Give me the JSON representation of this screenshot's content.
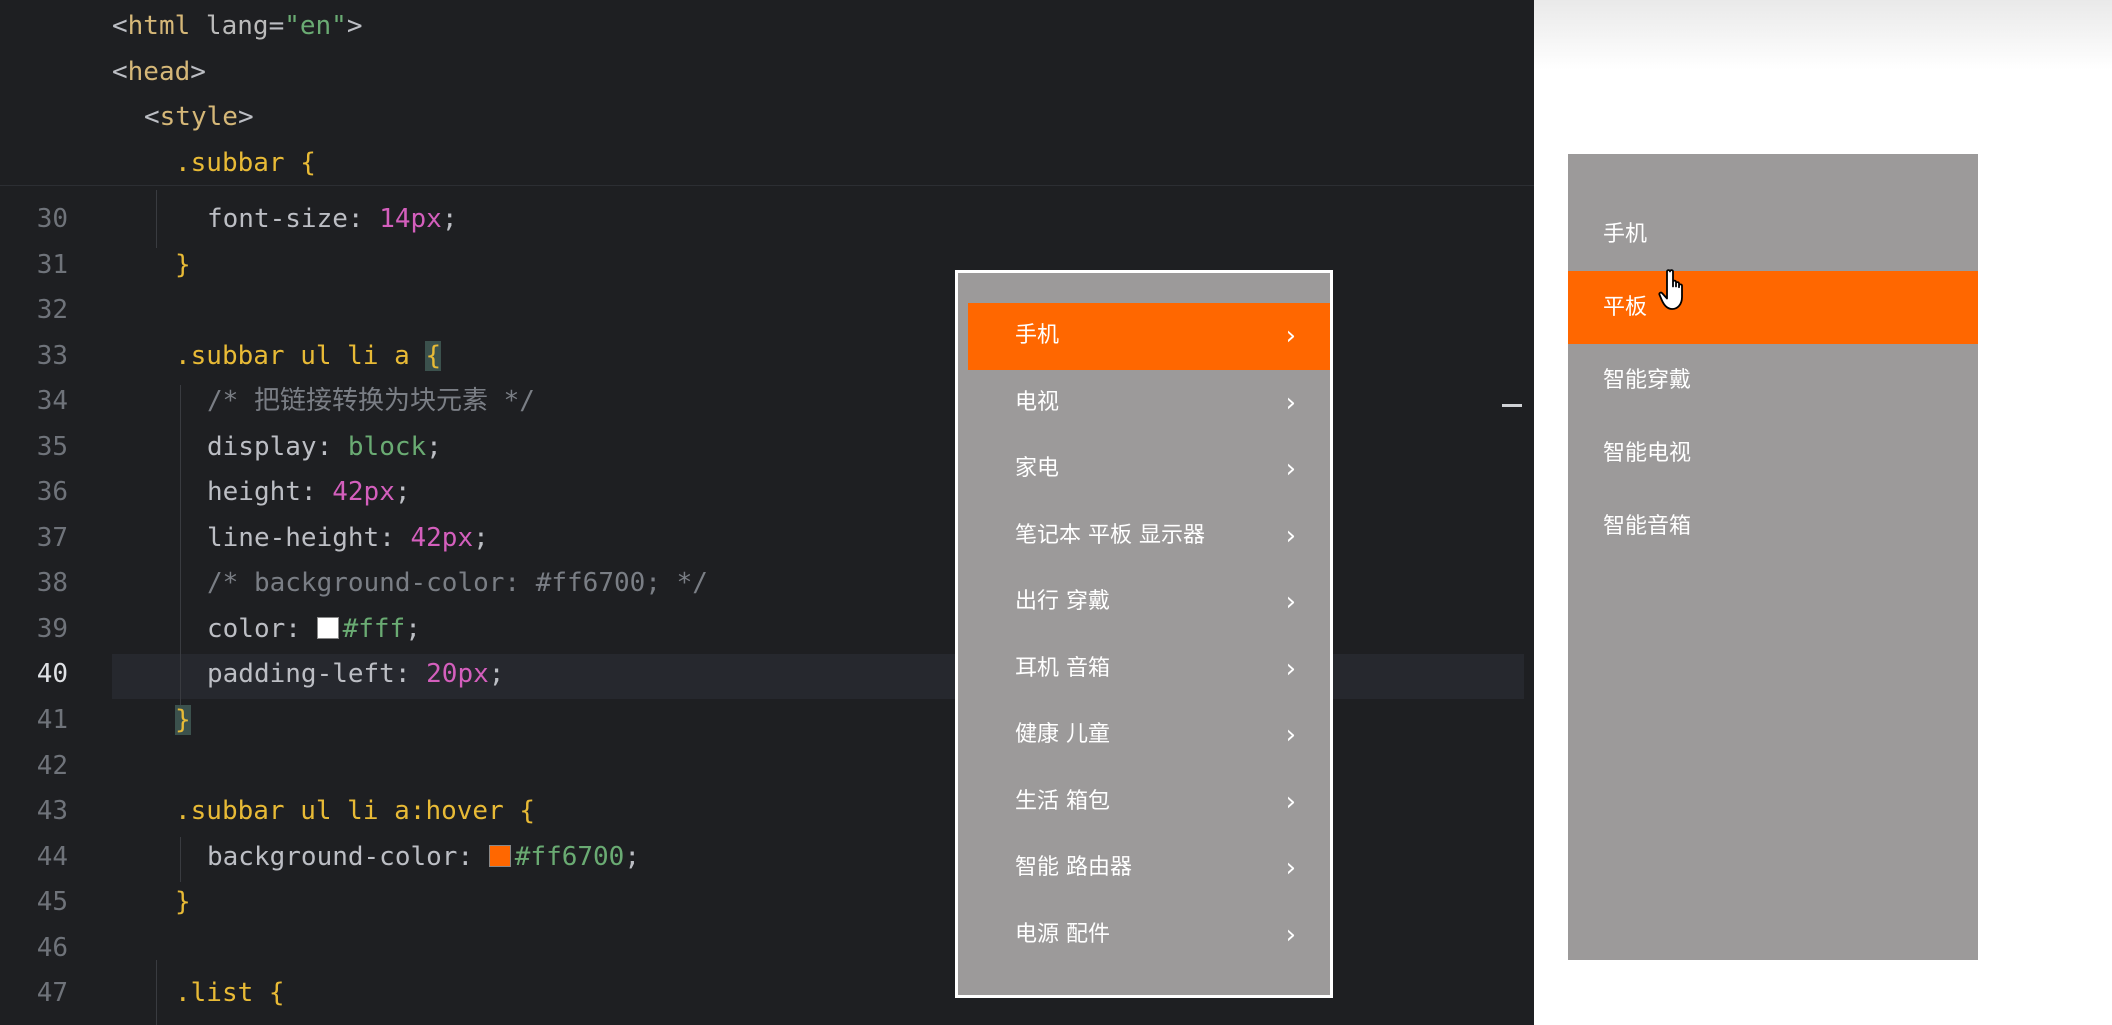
{
  "editor": {
    "sticky_lines": [
      {
        "tag_open": "<",
        "tag": "html",
        "attr": " lang",
        "eq": "=",
        "val": "\"en\"",
        "tag_close": ">"
      },
      {
        "tag_open": "<",
        "tag": "head",
        "tag_close": ">"
      },
      {
        "tag_open": "<",
        "tag": "style",
        "tag_close": ">"
      },
      {
        "selector": ".subbar",
        "brace": " {"
      }
    ],
    "line_numbers": [
      "30",
      "31",
      "32",
      "33",
      "34",
      "35",
      "36",
      "37",
      "38",
      "39",
      "40",
      "41",
      "42",
      "43",
      "44",
      "45",
      "46",
      "47"
    ],
    "current_line": "40",
    "lines": {
      "l30": {
        "prop": "font-size",
        "colon": ": ",
        "value": "14px",
        "semi": ";"
      },
      "l31": {
        "brace": "}"
      },
      "l33": {
        "selector": ".subbar ul li a",
        "brace": "{"
      },
      "l34": {
        "comment": "/* 把链接转换为块元素 */"
      },
      "l35": {
        "prop": "display",
        "colon": ": ",
        "value": "block",
        "semi": ";"
      },
      "l36": {
        "prop": "height",
        "colon": ": ",
        "value": "42px",
        "semi": ";"
      },
      "l37": {
        "prop": "line-height",
        "colon": ": ",
        "value": "42px",
        "semi": ";"
      },
      "l38": {
        "comment": "/* background-color: #ff6700; */"
      },
      "l39": {
        "prop": "color",
        "colon": ": ",
        "value": "#fff",
        "semi": ";",
        "swatch": "#ffffff"
      },
      "l40": {
        "prop": "padding-left",
        "colon": ": ",
        "value": "20px",
        "semi": ";"
      },
      "l41": {
        "brace": "}"
      },
      "l43": {
        "selector": ".subbar ul li a:hover",
        "brace": " {"
      },
      "l44": {
        "prop": "background-color",
        "colon": ": ",
        "value": "#ff6700",
        "semi": ";",
        "swatch": "#ff6700"
      },
      "l45": {
        "brace": "}"
      },
      "l47": {
        "selector": ".list",
        "brace": " {"
      }
    }
  },
  "menu_left": {
    "chevron": "›",
    "items": [
      {
        "label": "手机",
        "active": true
      },
      {
        "label": "电视"
      },
      {
        "label": "家电"
      },
      {
        "label": "笔记本 平板 显示器"
      },
      {
        "label": "出行 穿戴"
      },
      {
        "label": "耳机 音箱"
      },
      {
        "label": "健康 儿童"
      },
      {
        "label": "生活 箱包"
      },
      {
        "label": "智能 路由器"
      },
      {
        "label": "电源 配件"
      }
    ]
  },
  "menu_right": {
    "items": [
      {
        "label": "手机"
      },
      {
        "label": "平板",
        "active": true
      },
      {
        "label": "智能穿戴"
      },
      {
        "label": "智能电视"
      },
      {
        "label": "智能音箱"
      }
    ]
  },
  "colors": {
    "accent": "#ff6700",
    "menu_bg": "#9c9a9a",
    "editor_bg": "#1e1f22"
  },
  "icons": {
    "chevron": "chevron-right-icon",
    "cursor": "hand-pointer-icon"
  }
}
